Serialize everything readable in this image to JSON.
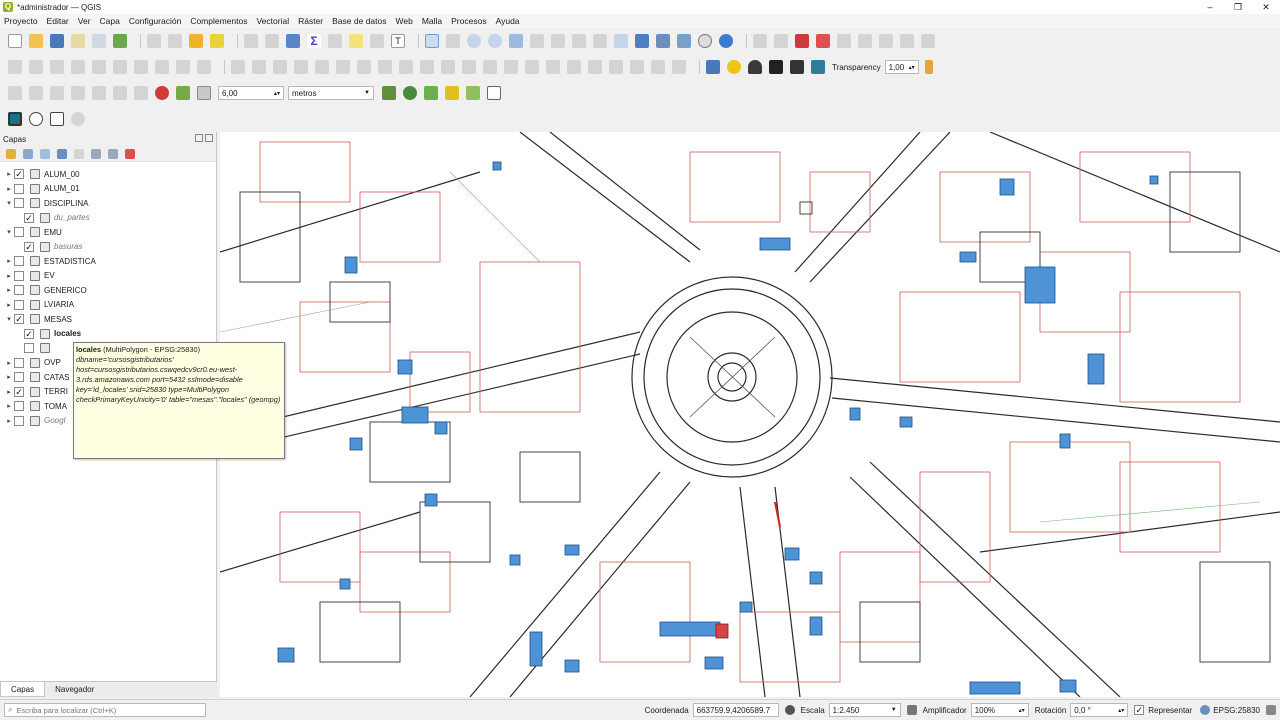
{
  "window": {
    "title": "*administrador — QGIS",
    "minimize": "–",
    "maximize": "❐",
    "close": "✕"
  },
  "menu": [
    "Proyecto",
    "Editar",
    "Ver",
    "Capa",
    "Configuración",
    "Complementos",
    "Vectorial",
    "Ráster",
    "Base de datos",
    "Web",
    "Malla",
    "Procesos",
    "Ayuda"
  ],
  "toolbar": {
    "transparency_label": "Transparency",
    "transparency_value": "1,00",
    "snap_tolerance": "6,00",
    "snap_units": "metros"
  },
  "layers_panel": {
    "title": "Capas",
    "layers": [
      {
        "name": "ALUM_00",
        "checked": true,
        "expanded": false,
        "indent": 0,
        "italic": false
      },
      {
        "name": "ALUM_01",
        "checked": false,
        "expanded": false,
        "indent": 0,
        "italic": false
      },
      {
        "name": "DISCIPLINA",
        "checked": false,
        "expanded": true,
        "indent": 0,
        "italic": false
      },
      {
        "name": "du_partes",
        "checked": true,
        "expanded": false,
        "indent": 1,
        "italic": true
      },
      {
        "name": "EMU",
        "checked": false,
        "expanded": true,
        "indent": 0,
        "italic": false
      },
      {
        "name": "basuras",
        "checked": true,
        "expanded": false,
        "indent": 1,
        "italic": true
      },
      {
        "name": "ESTADISTICA",
        "checked": false,
        "expanded": false,
        "indent": 0,
        "italic": false
      },
      {
        "name": "EV",
        "checked": false,
        "expanded": false,
        "indent": 0,
        "italic": false
      },
      {
        "name": "GENERICO",
        "checked": false,
        "expanded": false,
        "indent": 0,
        "italic": false
      },
      {
        "name": "LVIARIA",
        "checked": false,
        "expanded": false,
        "indent": 0,
        "italic": false
      },
      {
        "name": "MESAS",
        "checked": true,
        "expanded": true,
        "indent": 0,
        "italic": false
      },
      {
        "name": "locales",
        "checked": true,
        "expanded": false,
        "indent": 1,
        "italic": false
      },
      {
        "name": "",
        "checked": false,
        "expanded": false,
        "indent": 1,
        "italic": false
      },
      {
        "name": "OVP",
        "checked": false,
        "expanded": false,
        "indent": 0,
        "italic": false
      },
      {
        "name": "CATAS",
        "checked": false,
        "expanded": false,
        "indent": 0,
        "italic": false
      },
      {
        "name": "TERRI",
        "checked": true,
        "expanded": false,
        "indent": 0,
        "italic": false
      },
      {
        "name": "TOMA",
        "checked": false,
        "expanded": false,
        "indent": 0,
        "italic": false
      },
      {
        "name": "Googl",
        "checked": false,
        "expanded": false,
        "indent": 0,
        "italic": true
      }
    ],
    "tooltip_header_bold": "locales",
    "tooltip_header_rest": " (MultiPolygon - EPSG:25830)",
    "tooltip_body": "dbname='cursosgistributarios' host=cursosgistributarios.cswqedcv9cr0.eu-west-3.rds.amazonaws.com port=5432 sslmode=disable key='id_locales' srid=25830 type=MultiPolygon checkPrimaryKeyUnicity='0' table=\"mesas\".\"locales\" (geompg)",
    "tabs": [
      "Capas",
      "Navegador"
    ]
  },
  "statusbar": {
    "locator_placeholder": "Escriba para localizar (Ctrl+K)",
    "coordinate_label": "Coordenada",
    "coordinate_value": "663759.9,4206589.7",
    "scale_label": "Escala",
    "scale_value": "1:2.450",
    "magnifier_label": "Amplificador",
    "magnifier_value": "100%",
    "rotation_label": "Rotación",
    "rotation_value": "0,0 °",
    "render_label": "Representar",
    "crs": "EPSG:25830"
  }
}
